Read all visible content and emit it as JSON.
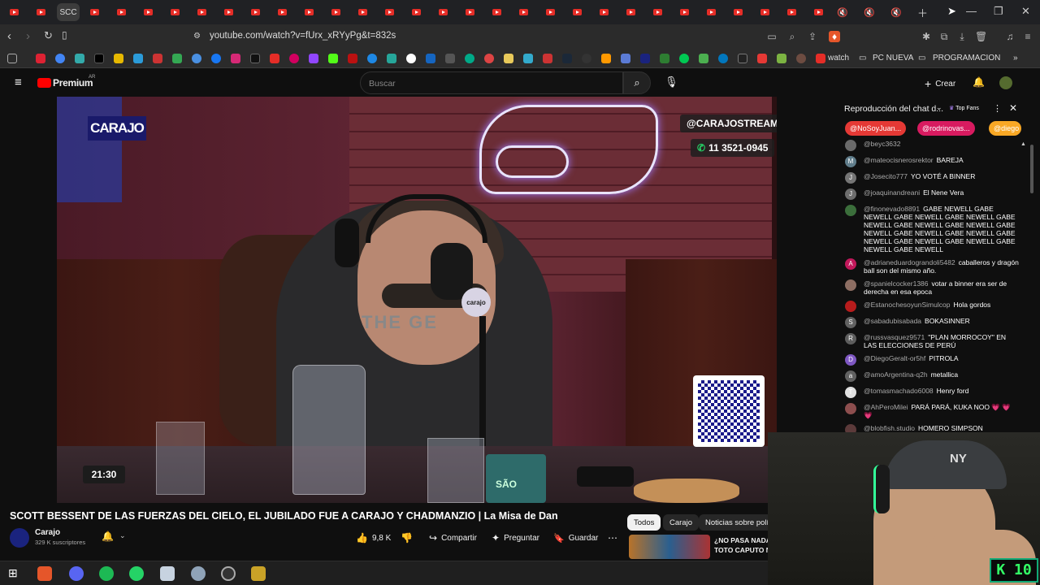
{
  "browser": {
    "active_tab_label": "SCC",
    "url": "youtube.com/watch?v=fUrx_xRYyPg&t=832s",
    "bookmarks": {
      "watch": "watch",
      "pc_nueva": "PC NUEVA",
      "programacion": "PROGRAMACION"
    }
  },
  "youtube": {
    "logo_text": "Premium",
    "logo_region": "AR",
    "search_placeholder": "Buscar",
    "create_label": "Crear"
  },
  "video": {
    "overlay_brand": "CARAJO",
    "overlay_handle": "@CARAJOSTREAM",
    "overlay_phone": "11 3521-0945",
    "mic_brand": "carajo",
    "mug_text": "SÃO",
    "timer": "21:30",
    "shirt_text": "THE GE",
    "title": "SCOTT BESSENT DE LAS FUERZAS DEL CIELO, EL JUBILADO FUE A CARAJO Y CHADMANZIO | La Misa de Dan",
    "channel_name": "Carajo",
    "subscribers": "329 K suscriptores",
    "likes": "9,8 K",
    "share_label": "Compartir",
    "ask_label": "Preguntar",
    "save_label": "Guardar"
  },
  "filters": {
    "todos": "Todos",
    "carajo": "Carajo",
    "noticias": "Noticias sobre polític"
  },
  "related": {
    "line1": "¿NO PASA NADA",
    "line2": "TOTO CAPUTO NO"
  },
  "chat": {
    "header": "Reproducción del chat d...",
    "top_fans": "Top Fans",
    "chips": [
      "@NoSoyJuan...",
      "@rodrinovas...",
      "@diego"
    ],
    "messages": [
      {
        "author": "@beyc3632",
        "text": "",
        "initial": "",
        "color": "#6a6a6a"
      },
      {
        "author": "@mateocisnerosrektor",
        "text": "BAREJA",
        "initial": "M",
        "color": "#607d8b"
      },
      {
        "author": "@Josecito777",
        "text": "YO VOTÉ A BINNER",
        "initial": "J",
        "color": "#757575"
      },
      {
        "author": "@joaquinandreani",
        "text": "El Nene Vera",
        "initial": "J",
        "color": "#6d6d6d"
      },
      {
        "author": "@finonevado8891",
        "text": "GABE NEWELL GABE NEWELL GABE NEWELL GABE NEWELL GABE NEWELL GABE NEWELL GABE NEWELL GABE NEWELL GABE NEWELL GABE NEWELL GABE NEWELL GABE NEWELL GABE NEWELL GABE NEWELL GABE NEWELL",
        "initial": "",
        "color": "#3b6e3b"
      },
      {
        "author": "@adrianeduardograndoli5482",
        "text": "caballeros y dragón ball son del mismo año.",
        "initial": "A",
        "color": "#c2185b"
      },
      {
        "author": "@spanielcocker1386",
        "text": "votar a binner era ser de derecha en esa epoca",
        "initial": "",
        "color": "#8d6e63"
      },
      {
        "author": "@EstanochesoyunSimulcop",
        "text": "Hola gordos",
        "initial": "",
        "color": "#b71c1c"
      },
      {
        "author": "@sabadubisabada",
        "text": "BOKASINNER",
        "initial": "S",
        "color": "#616161"
      },
      {
        "author": "@russvasquez9571",
        "text": "\"PLAN MORROCOY\" EN LAS ELECCIONES DE PERÚ",
        "initial": "R",
        "color": "#5d5d5d"
      },
      {
        "author": "@DiegoGeralt-or5hf",
        "text": "PITROLA",
        "initial": "D",
        "color": "#7e57c2"
      },
      {
        "author": "@amoArgentina-q2h",
        "text": "metallica",
        "initial": "a",
        "color": "#616161"
      },
      {
        "author": "@tomasmachado6008",
        "text": "Henry ford",
        "initial": "T",
        "color": "#e0e0e0"
      },
      {
        "author": "@AhPeroMilei",
        "text": "PARÁ PARÁ, KUKA NOO 💗 💗 💗",
        "initial": "",
        "color": "#8d4e4e"
      },
      {
        "author": "@blobfish.studio",
        "text": "HOMERO SIMPSON",
        "initial": "",
        "color": "#5c3a3a"
      }
    ]
  },
  "webcam": {
    "cap_text": "NY",
    "badge_text": "K 10"
  }
}
